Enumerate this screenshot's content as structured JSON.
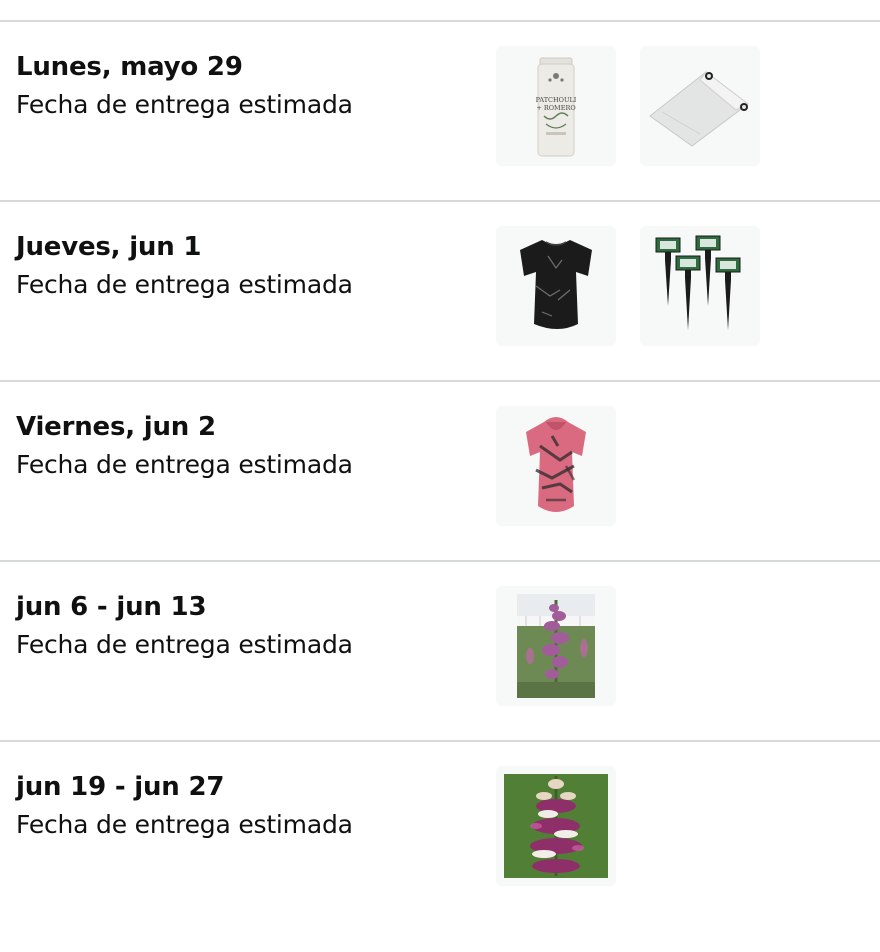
{
  "deliveries": [
    {
      "date": "Lunes, mayo 29",
      "label": "Fecha de entrega estimada",
      "items": [
        {
          "icon": "incense-tube-icon",
          "tube_text_1": "PATCHOULI",
          "tube_text_2": "+ ROMERO"
        },
        {
          "icon": "tarp-icon"
        }
      ]
    },
    {
      "date": "Jueves, jun 1",
      "label": "Fecha de entrega estimada",
      "items": [
        {
          "icon": "black-tshirt-icon"
        },
        {
          "icon": "solar-stakes-icon"
        }
      ]
    },
    {
      "date": "Viernes, jun 2",
      "label": "Fecha de entrega estimada",
      "items": [
        {
          "icon": "pink-hooded-shirt-icon"
        }
      ]
    },
    {
      "date": "jun 6 - jun 13",
      "label": "Fecha de entrega estimada",
      "items": [
        {
          "icon": "flower-plant-photo-icon"
        }
      ]
    },
    {
      "date": "jun 19 - jun 27",
      "label": "Fecha de entrega estimada",
      "items": [
        {
          "icon": "flower-closeup-photo-icon"
        }
      ]
    }
  ],
  "colors": {
    "divider": "#d5d9d9",
    "thumb_bg": "#f7f8f8",
    "text": "#0f1111"
  }
}
